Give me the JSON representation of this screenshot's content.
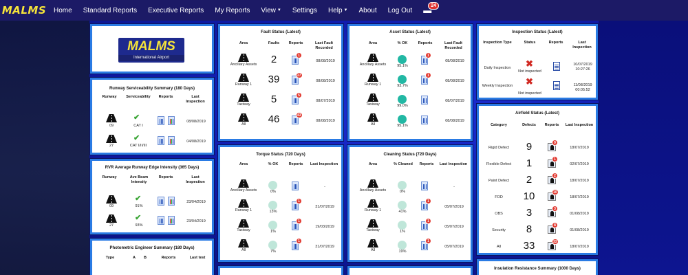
{
  "nav": {
    "logo": "MALMS",
    "items": [
      "Home",
      "Standard Reports",
      "Executive Reports",
      "My Reports",
      "View",
      "Settings",
      "Help",
      "About",
      "Log Out"
    ],
    "notifications": "24"
  },
  "logo_panel": {
    "title": "MALMS",
    "subtitle": "International Airport"
  },
  "runway": {
    "title": "Runway Serviceability Summary (180 Days)",
    "headers": [
      "Runway",
      "Serviceability",
      "Reports",
      "Last Inspection"
    ],
    "rows": [
      {
        "runway": "09",
        "status": "CAT I",
        "last": "08/08/2019"
      },
      {
        "runway": "27",
        "status": "CAT I/II/III",
        "last": "04/08/2019"
      }
    ]
  },
  "rvr": {
    "title": "RVR Average Runway Edge Intensity (365 Days)",
    "headers": [
      "Runway",
      "Ave Beam Intensity",
      "Reports",
      "Last Inspection"
    ],
    "rows": [
      {
        "runway": "09",
        "value": "91%",
        "last": "23/04/2019"
      },
      {
        "runway": "27",
        "value": "93%",
        "last": "23/04/2019"
      }
    ]
  },
  "photo": {
    "title": "Photometric Engineer Summary (180 Days)",
    "headers": [
      "Type",
      "A",
      "B",
      "Reports",
      "Last test"
    ]
  },
  "fault": {
    "title": "Fault Status (Latest)",
    "headers": [
      "Area",
      "Faults",
      "Reports",
      "Last Fault Recorded"
    ],
    "rows": [
      {
        "area": "Ancillary Assets",
        "faults": "2",
        "badge": "1",
        "last": "08/08/2019"
      },
      {
        "area": "Runway 1",
        "faults": "39",
        "badge": "27",
        "last": "08/08/2019"
      },
      {
        "area": "Taxiway",
        "faults": "5",
        "badge": "5",
        "last": "08/07/2019"
      },
      {
        "area": "All",
        "faults": "46",
        "badge": "43",
        "last": "08/08/2019"
      }
    ]
  },
  "asset": {
    "title": "Asset Status (Latest)",
    "headers": [
      "Area",
      "% OK",
      "Reports",
      "Last Fault Recorded"
    ],
    "rows": [
      {
        "area": "Ancillary Assets",
        "pct": "95.1%",
        "badge": "1",
        "last": "08/08/2019"
      },
      {
        "area": "Runway 1",
        "pct": "93.7%",
        "badge": "1",
        "last": "08/08/2019"
      },
      {
        "area": "Taxiway",
        "pct": "99.0%",
        "badge": "",
        "last": "08/07/2019"
      },
      {
        "area": "All",
        "pct": "95.1%",
        "badge": "",
        "last": "08/08/2019"
      }
    ]
  },
  "inspection": {
    "title": "Inspection Status (Latest)",
    "headers": [
      "Inspection Type",
      "Status",
      "Reports",
      "Last Inspection"
    ],
    "rows": [
      {
        "type": "Daily Inspection",
        "status": "Not inspected",
        "last": "10/07/2019 10:27:26"
      },
      {
        "type": "Weekly Inspection",
        "status": "Not inspected",
        "last": "11/08/2019 00:05:52"
      }
    ]
  },
  "torque": {
    "title": "Torque Status (720 Days)",
    "headers": [
      "Area",
      "% OK",
      "Reports",
      "Last Inspection"
    ],
    "rows": [
      {
        "area": "Ancillary Assets",
        "pct": "0%",
        "badge": "",
        "last": "-"
      },
      {
        "area": "Runway 1",
        "pct": "13%",
        "badge": "1",
        "last": "31/07/2019"
      },
      {
        "area": "Taxiway",
        "pct": "1%",
        "badge": "1",
        "last": "19/03/2019"
      },
      {
        "area": "All",
        "pct": "7%",
        "badge": "1",
        "last": "31/07/2019"
      }
    ]
  },
  "cleaning": {
    "title": "Cleaning Status (720 Days)",
    "headers": [
      "Area",
      "% Cleaned",
      "Reports",
      "Last Inspection"
    ],
    "rows": [
      {
        "area": "Ancillary Assets",
        "pct": "0%",
        "badge": "",
        "last": "-"
      },
      {
        "area": "Runway 1",
        "pct": "41%",
        "badge": "1",
        "last": "05/07/2019"
      },
      {
        "area": "Taxiway",
        "pct": "1%",
        "badge": "1",
        "last": "05/07/2019"
      },
      {
        "area": "All",
        "pct": "19%",
        "badge": "1",
        "last": "05/07/2019"
      }
    ]
  },
  "airfield": {
    "title": "Airfield Status (Latest)",
    "headers": [
      "Category",
      "Defects",
      "Reports",
      "Last Inspection"
    ],
    "rows": [
      {
        "cat": "Rigid Defect",
        "n": "9",
        "badge": "9",
        "last": "18/07/2019"
      },
      {
        "cat": "Flexible Defect",
        "n": "1",
        "badge": "1",
        "last": "02/07/2019"
      },
      {
        "cat": "Paint Defect",
        "n": "2",
        "badge": "2",
        "last": "18/07/2019"
      },
      {
        "cat": "FOD",
        "n": "10",
        "badge": "10",
        "last": "18/07/2019"
      },
      {
        "cat": "OBS",
        "n": "3",
        "badge": "3",
        "last": "01/08/2019"
      },
      {
        "cat": "Security",
        "n": "8",
        "badge": "8",
        "last": "01/08/2019"
      },
      {
        "cat": "All",
        "n": "33",
        "badge": "33",
        "last": "18/07/2019"
      }
    ]
  },
  "insulation": {
    "title": "Insulation Resistance Summary (1000 Days)"
  }
}
